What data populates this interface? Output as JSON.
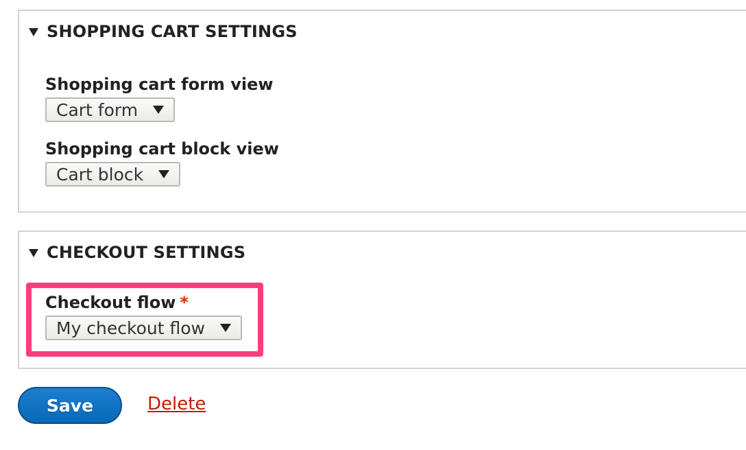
{
  "cart_settings": {
    "legend": "SHOPPING CART SETTINGS",
    "cart_form_view": {
      "label": "Shopping cart form view",
      "selected": "Cart form"
    },
    "cart_block_view": {
      "label": "Shopping cart block view",
      "selected": "Cart block"
    }
  },
  "checkout_settings": {
    "legend": "CHECKOUT SETTINGS",
    "checkout_flow": {
      "label": "Checkout flow",
      "required_marker": "*",
      "selected": "My checkout flow"
    }
  },
  "actions": {
    "save_label": "Save",
    "delete_label": "Delete"
  },
  "colors": {
    "highlight": "#ff3c7e",
    "save_button": "#0868b8",
    "delete_link": "#c41a00",
    "required": "#e62600"
  },
  "icons": {
    "collapse": "triangle-down-icon",
    "select": "chevron-down-icon"
  }
}
